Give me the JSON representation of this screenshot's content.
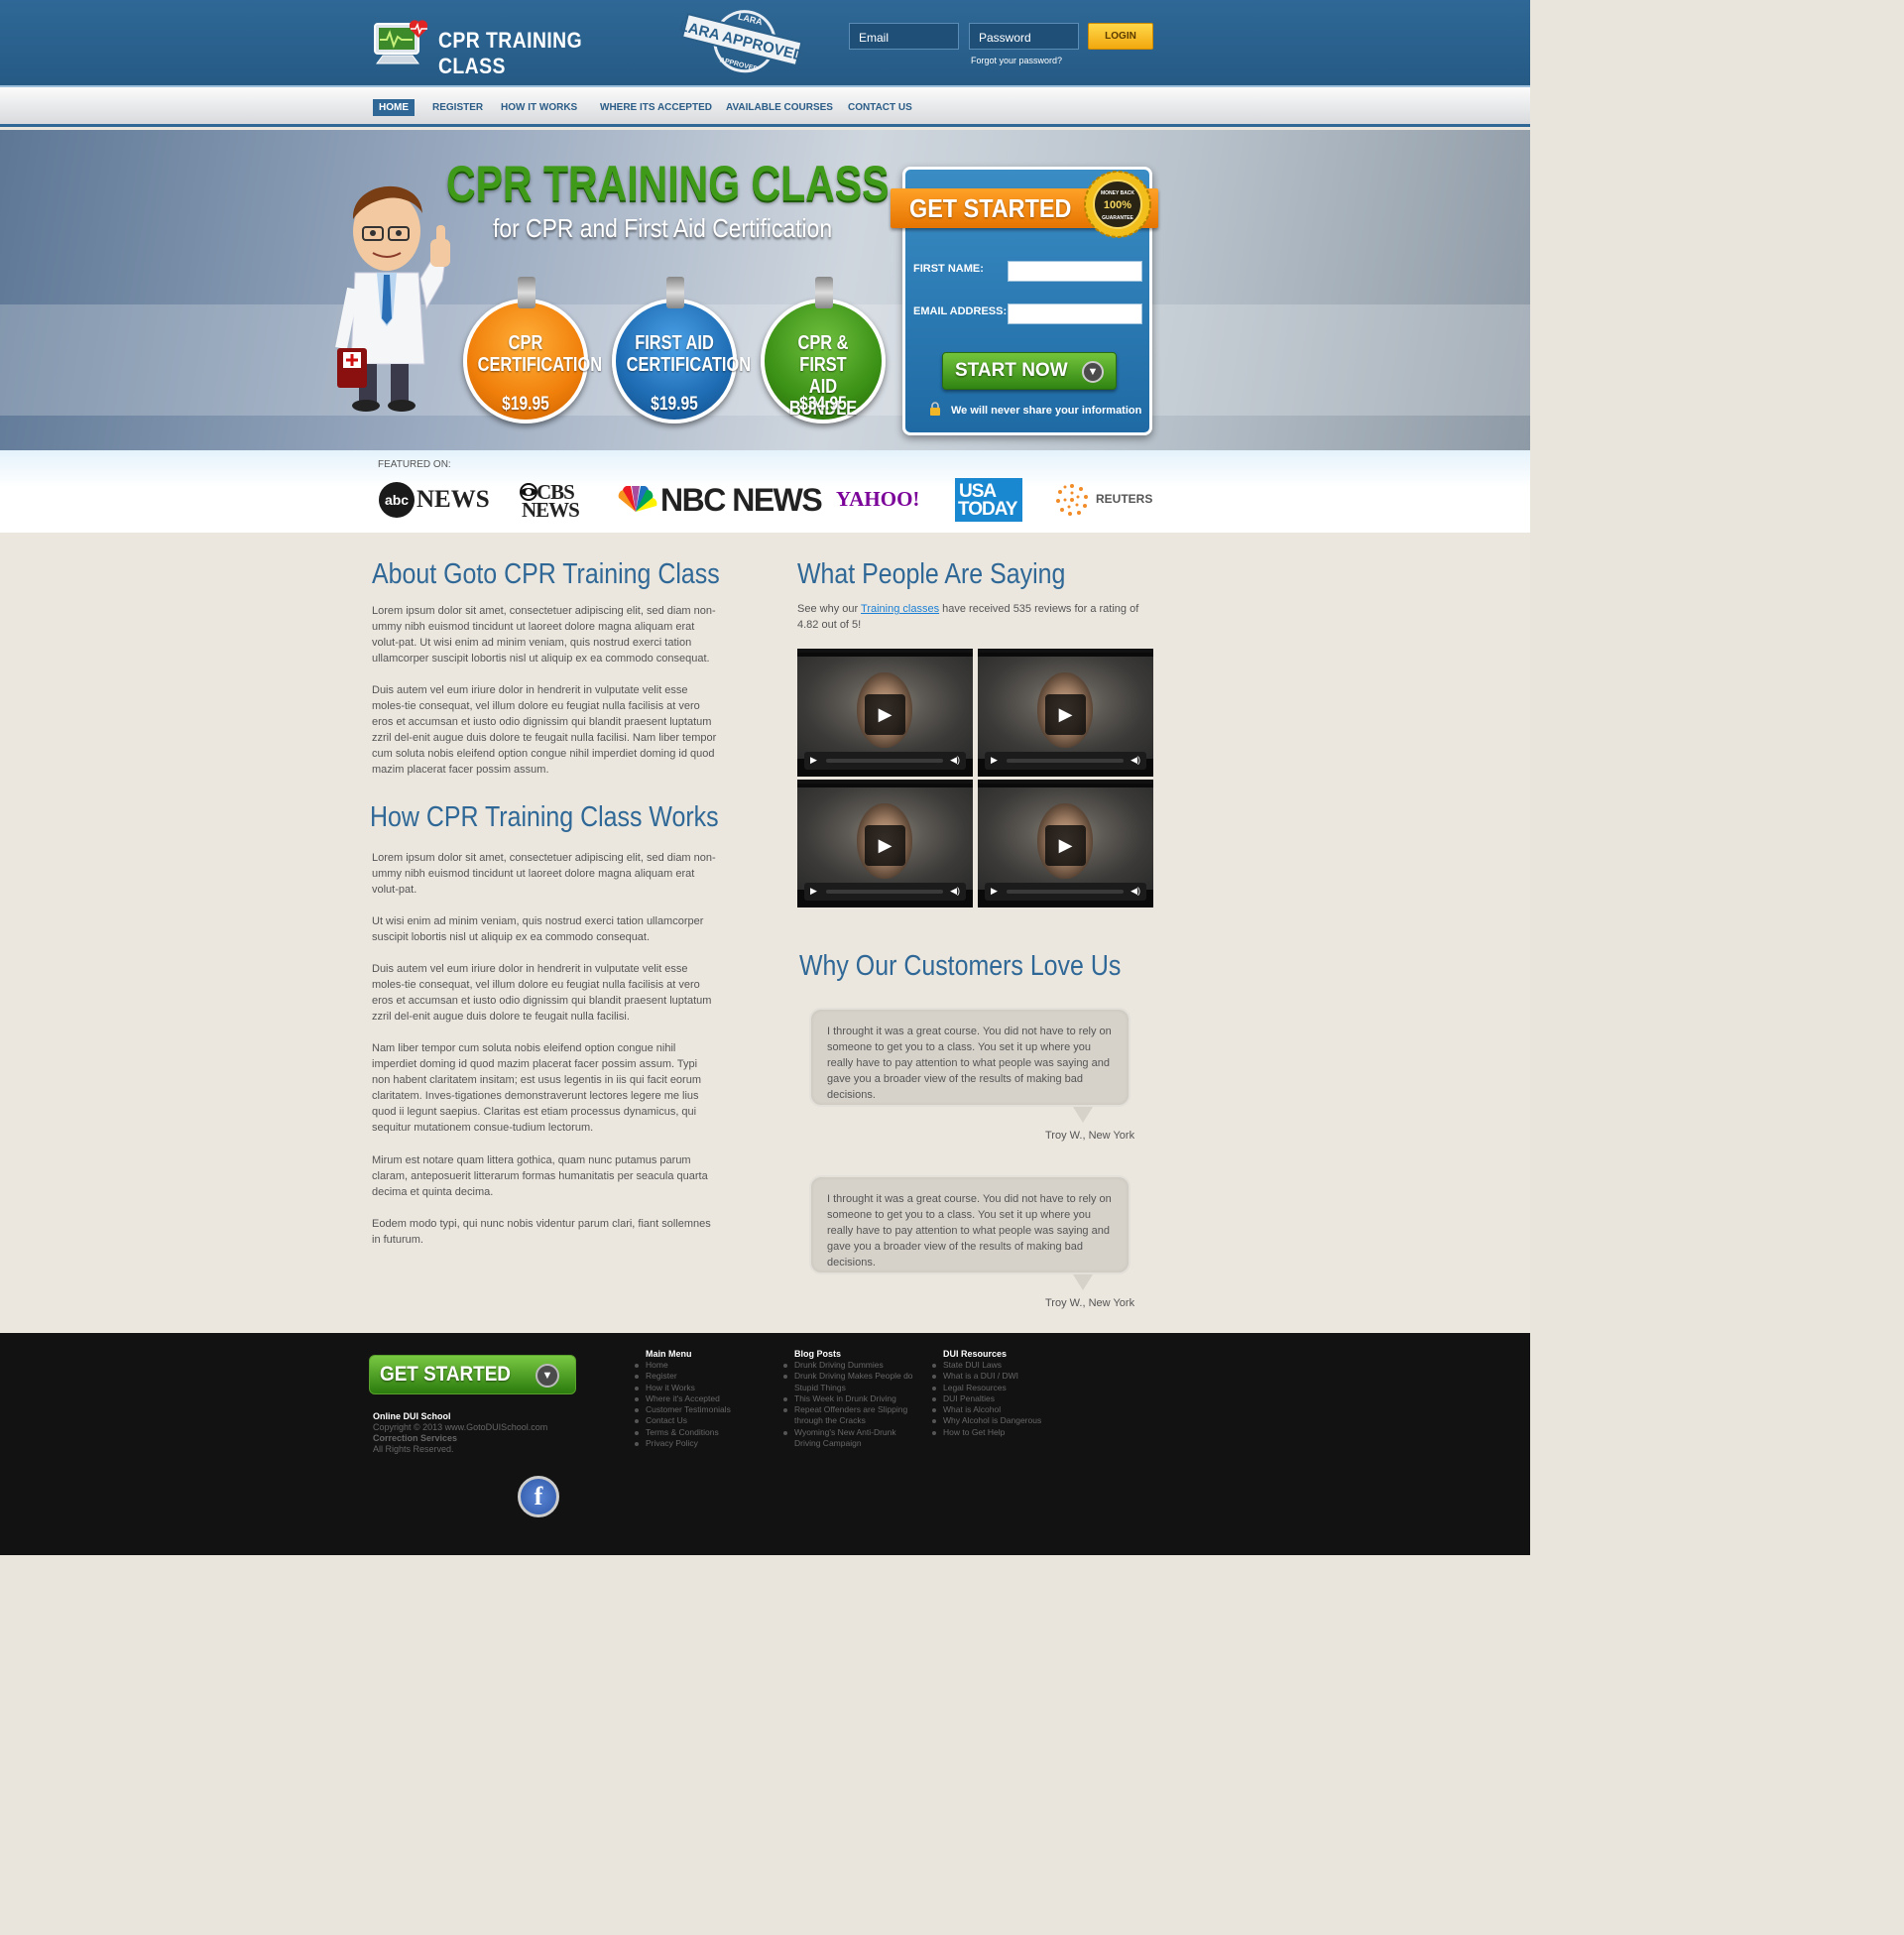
{
  "header": {
    "logo_text": "CPR TRAINING CLASS",
    "stamp_top": "LARA",
    "stamp_main": "LARA APPROVED",
    "stamp_bottom": "APPROVED",
    "email_placeholder": "Email",
    "password_placeholder": "Password",
    "login_label": "LOGIN",
    "forgot_label": "Forgot your password?"
  },
  "nav": {
    "items": [
      {
        "label": "HOME",
        "active": true
      },
      {
        "label": "REGISTER"
      },
      {
        "label": "HOW IT WORKS"
      },
      {
        "label": "WHERE ITS ACCEPTED"
      },
      {
        "label": "AVAILABLE COURSES"
      },
      {
        "label": "CONTACT US"
      }
    ]
  },
  "hero": {
    "title": "CPR TRAINING CLASS",
    "subtitle": "for CPR and First Aid Certification",
    "badges": [
      {
        "line1": "CPR",
        "line2": "CERTIFICATION",
        "price": "$19.95",
        "color": "#f07f0a"
      },
      {
        "line1": "FIRST AID",
        "line2": "CERTIFICATION",
        "price": "$19.95",
        "color": "#1f6db4"
      },
      {
        "line1": "CPR & FIRST",
        "line2": "AID BUNDLE",
        "price": "$34.95",
        "color": "#3c9216"
      }
    ],
    "form": {
      "ribbon": "GET STARTED",
      "seal_top": "MONEY BACK",
      "seal_mid": "100%",
      "seal_bottom": "GUARANTEE",
      "first_name_label": "FIRST NAME:",
      "email_label": "EMAIL ADDRESS:",
      "submit_label": "START NOW",
      "privacy_note": "We will never share your information"
    }
  },
  "featured": {
    "label": "FEATURED ON:",
    "logos": [
      {
        "icon": "abc-logo",
        "text": "NEWS"
      },
      {
        "icon": "cbs-eye-logo",
        "text1": "CBS",
        "text2": "NEWS"
      },
      {
        "icon": "nbc-peacock-logo",
        "text": "NBC NEWS"
      },
      {
        "icon": "yahoo-logo",
        "text": "YAHOO!"
      },
      {
        "icon": "usa-today-logo",
        "text1": "USA",
        "text2": "TODAY"
      },
      {
        "icon": "reuters-logo",
        "text": "REUTERS"
      }
    ]
  },
  "about": {
    "title": "About Goto CPR Training Class",
    "paragraphs": [
      "Lorem ipsum dolor sit amet, consectetuer adipiscing elit, sed diam non-ummy nibh euismod tincidunt ut laoreet dolore magna aliquam erat volut-pat. Ut wisi enim ad minim veniam, quis nostrud exerci tation ullamcorper suscipit lobortis nisl ut aliquip ex ea commodo consequat.",
      "Duis autem vel eum iriure dolor in hendrerit in vulputate velit esse moles-tie consequat, vel illum dolore eu feugiat nulla facilisis at vero eros et accumsan et iusto odio dignissim qui blandit praesent luptatum zzril del-enit augue duis dolore te feugait nulla facilisi. Nam liber tempor cum soluta nobis eleifend option congue nihil imperdiet doming id quod mazim placerat facer possim assum."
    ]
  },
  "how": {
    "title": "How CPR Training Class Works",
    "paragraphs": [
      "Lorem ipsum dolor sit amet, consectetuer adipiscing elit, sed diam non-ummy nibh euismod tincidunt ut laoreet dolore magna aliquam erat volut-pat.",
      "Ut wisi enim ad minim veniam, quis nostrud exerci tation ullamcorper suscipit lobortis nisl ut aliquip ex ea commodo consequat.",
      " Duis autem vel eum iriure dolor in hendrerit in vulputate velit esse moles-tie consequat, vel illum dolore eu feugiat nulla facilisis at vero eros et accumsan et iusto odio dignissim qui blandit praesent luptatum zzril del-enit augue duis dolore te feugait nulla facilisi.",
      "Nam liber tempor cum soluta nobis eleifend option congue nihil imperdiet doming id quod mazim placerat facer possim assum. Typi non habent claritatem insitam; est usus legentis in iis qui facit eorum claritatem. Inves-tigationes demonstraverunt lectores legere me lius quod ii legunt saepius. Claritas est etiam processus dynamicus, qui sequitur mutationem consue-tudium lectorum.",
      "Mirum est notare quam littera gothica, quam nunc putamus parum claram, anteposuerit litterarum formas humanitatis per seacula quarta decima et quinta decima.",
      "Eodem modo typi, qui nunc nobis videntur parum clari, fiant sollemnes in futurum."
    ]
  },
  "reviews": {
    "title": "What People Are Saying",
    "intro_before": "See why our ",
    "intro_link": "Training classes",
    "intro_after": " have received 535 reviews for a rating of 4.82 out of 5!",
    "videos": 4
  },
  "love": {
    "title": "Why Our Customers Love Us",
    "testimonials": [
      {
        "text": "I throught it was a great course. You did not have to rely on someone to get you to a class. You set it up where you really have to pay attention to what people was saying and gave you a broader view of the results of making bad decisions.",
        "author": "Troy W., New York"
      },
      {
        "text": "I throught it was a great course. You did not have to rely on someone to get you to a class. You set it up where you really have to pay attention to what people was saying and gave you a broader view of the results of making bad decisions.",
        "author": "Troy W., New York"
      }
    ]
  },
  "footer": {
    "get_started": "GET STARTED",
    "company": "Online DUI School",
    "copyright": "Copyright © 2013 www.GotoDUISchool.com",
    "division": "Correction Services",
    "rights": "All Rights Reserved.",
    "columns": [
      {
        "title": "Main Menu",
        "items": [
          "Home",
          "Register",
          "How it Works",
          "Where it's Accepted",
          "Customer Testimonials",
          "Contact Us",
          "Terms & Conditions",
          "Privacy Policy"
        ]
      },
      {
        "title": "Blog Posts",
        "items": [
          "Drunk Driving Dummies",
          "Drunk Driving Makes People do Stupid Things",
          "This Week in Drunk Driving",
          "Repeat Offenders are Slipping through the Cracks",
          "Wyoming's New Anti-Drunk Driving Campaign"
        ]
      },
      {
        "title": "DUI Resources",
        "items": [
          "State DUI Laws",
          "What is a DUI / DWI",
          "Legal Resources",
          "DUI Penalties",
          "What is Alcohol",
          "Why Alcohol is Dangerous",
          "How to Get Help"
        ]
      }
    ],
    "facebook_letter": "f"
  }
}
